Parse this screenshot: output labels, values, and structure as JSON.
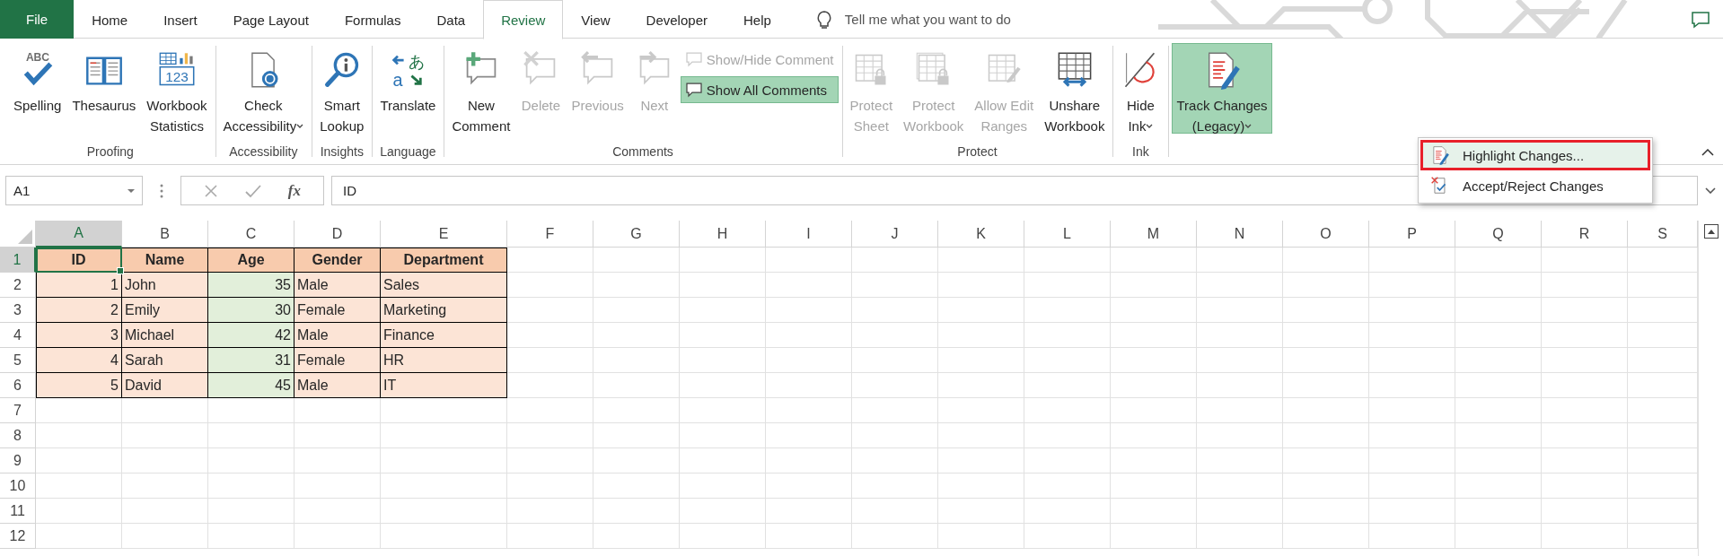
{
  "tabs": [
    {
      "label": "File",
      "kind": "file",
      "selected": false
    },
    {
      "label": "Home",
      "kind": "tab",
      "selected": false
    },
    {
      "label": "Insert",
      "kind": "tab",
      "selected": false
    },
    {
      "label": "Page Layout",
      "kind": "tab",
      "selected": false
    },
    {
      "label": "Formulas",
      "kind": "tab",
      "selected": false
    },
    {
      "label": "Data",
      "kind": "tab",
      "selected": false
    },
    {
      "label": "Review",
      "kind": "tab",
      "selected": true
    },
    {
      "label": "View",
      "kind": "tab",
      "selected": false
    },
    {
      "label": "Developer",
      "kind": "tab",
      "selected": false
    },
    {
      "label": "Help",
      "kind": "tab",
      "selected": false
    }
  ],
  "tell_me": {
    "placeholder": "Tell me what you want to do"
  },
  "ribbon": {
    "groups": [
      {
        "label": "Proofing",
        "buttons": [
          {
            "kind": "large",
            "label": "Spelling",
            "icon_texts": [
              "ABC"
            ],
            "disabled": false,
            "selected": false,
            "dropdown": false
          },
          {
            "kind": "large",
            "label": "Thesaurus",
            "disabled": false,
            "selected": false,
            "dropdown": false
          },
          {
            "kind": "large",
            "label": "Workbook\nStatistics",
            "icon_texts": [
              "123"
            ],
            "disabled": false,
            "selected": false,
            "dropdown": false
          }
        ]
      },
      {
        "label": "Accessibility",
        "buttons": [
          {
            "kind": "large",
            "label": "Check\nAccessibility",
            "disabled": false,
            "selected": false,
            "dropdown": true
          }
        ]
      },
      {
        "label": "Insights",
        "buttons": [
          {
            "kind": "large",
            "label": "Smart\nLookup",
            "disabled": false,
            "selected": false,
            "dropdown": false
          }
        ]
      },
      {
        "label": "Language",
        "buttons": [
          {
            "kind": "large",
            "label": "Translate",
            "icon_texts": [
              "あ",
              "a"
            ],
            "disabled": false,
            "selected": false,
            "dropdown": false
          }
        ]
      },
      {
        "label": "Comments",
        "buttons": [
          {
            "kind": "large",
            "label": "New\nComment",
            "disabled": false,
            "selected": false,
            "dropdown": false
          },
          {
            "kind": "large",
            "label": "Delete",
            "disabled": true,
            "selected": false,
            "dropdown": false
          },
          {
            "kind": "large",
            "label": "Previous",
            "disabled": true,
            "selected": false,
            "dropdown": false
          },
          {
            "kind": "large",
            "label": "Next",
            "disabled": true,
            "selected": false,
            "dropdown": false
          },
          {
            "kind": "small",
            "label": "Show/Hide Comment",
            "disabled": true,
            "selected": false,
            "dropdown": false
          },
          {
            "kind": "small",
            "label": "Show All Comments",
            "disabled": false,
            "selected": true,
            "dropdown": false
          }
        ]
      },
      {
        "label": "Protect",
        "buttons": [
          {
            "kind": "large",
            "label": "Protect\nSheet",
            "disabled": true,
            "selected": false,
            "dropdown": false
          },
          {
            "kind": "large",
            "label": "Protect\nWorkbook",
            "disabled": true,
            "selected": false,
            "dropdown": false
          },
          {
            "kind": "large",
            "label": "Allow Edit\nRanges",
            "disabled": true,
            "selected": false,
            "dropdown": false
          },
          {
            "kind": "large",
            "label": "Unshare\nWorkbook",
            "disabled": false,
            "selected": false,
            "dropdown": false
          }
        ]
      },
      {
        "label": "Ink",
        "buttons": [
          {
            "kind": "large",
            "label": "Hide\nInk",
            "disabled": false,
            "selected": false,
            "dropdown": true
          }
        ]
      },
      {
        "buttons": [
          {
            "kind": "large",
            "label": "Track Changes\n(Legacy)",
            "disabled": false,
            "selected": true,
            "dropdown": true
          }
        ]
      }
    ]
  },
  "formula_bar": {
    "name_box": "A1",
    "function_label": "fx",
    "formula": "ID"
  },
  "sheet": {
    "columns": [
      {
        "letter": "A",
        "selected": true
      },
      {
        "letter": "B",
        "selected": false
      },
      {
        "letter": "C",
        "selected": false
      },
      {
        "letter": "D",
        "selected": false
      },
      {
        "letter": "E",
        "selected": false
      },
      {
        "letter": "F",
        "selected": false
      },
      {
        "letter": "G",
        "selected": false
      },
      {
        "letter": "H",
        "selected": false
      },
      {
        "letter": "I",
        "selected": false
      },
      {
        "letter": "J",
        "selected": false
      },
      {
        "letter": "K",
        "selected": false
      },
      {
        "letter": "L",
        "selected": false
      },
      {
        "letter": "M",
        "selected": false
      },
      {
        "letter": "N",
        "selected": false
      },
      {
        "letter": "O",
        "selected": false
      },
      {
        "letter": "P",
        "selected": false
      },
      {
        "letter": "Q",
        "selected": false
      },
      {
        "letter": "R",
        "selected": false
      },
      {
        "letter": "S",
        "selected": false
      }
    ],
    "rows": [
      {
        "number": "1",
        "selected": true,
        "cells": [
          {
            "text": "ID",
            "kind": "header",
            "color": "#f8cbad",
            "selected": true
          },
          {
            "text": "Name",
            "kind": "header",
            "color": "#f8cbad",
            "selected": false
          },
          {
            "text": "Age",
            "kind": "header",
            "color": "#f8cbad",
            "selected": false
          },
          {
            "text": "Gender",
            "kind": "header",
            "color": "#f8cbad",
            "selected": false
          },
          {
            "text": "Department",
            "kind": "header",
            "color": "#f8cbad",
            "selected": false
          }
        ]
      },
      {
        "number": "2",
        "selected": false,
        "cells": [
          {
            "text": "1",
            "kind": "number",
            "color": "#fce4d6",
            "selected": false
          },
          {
            "text": "John",
            "kind": "text",
            "color": "#fce4d6",
            "selected": false
          },
          {
            "text": "35",
            "kind": "number",
            "color": "#e2efda",
            "selected": false
          },
          {
            "text": "Male",
            "kind": "text",
            "color": "#fce4d6",
            "selected": false
          },
          {
            "text": "Sales",
            "kind": "text",
            "color": "#fce4d6",
            "selected": false
          }
        ]
      },
      {
        "number": "3",
        "selected": false,
        "cells": [
          {
            "text": "2",
            "kind": "number",
            "color": "#fce4d6",
            "selected": false
          },
          {
            "text": "Emily",
            "kind": "text",
            "color": "#fce4d6",
            "selected": false
          },
          {
            "text": "30",
            "kind": "number",
            "color": "#e2efda",
            "selected": false
          },
          {
            "text": "Female",
            "kind": "text",
            "color": "#fce4d6",
            "selected": false
          },
          {
            "text": "Marketing",
            "kind": "text",
            "color": "#fce4d6",
            "selected": false
          }
        ]
      },
      {
        "number": "4",
        "selected": false,
        "cells": [
          {
            "text": "3",
            "kind": "number",
            "color": "#fce4d6",
            "selected": false
          },
          {
            "text": "Michael",
            "kind": "text",
            "color": "#fce4d6",
            "selected": false
          },
          {
            "text": "42",
            "kind": "number",
            "color": "#e2efda",
            "selected": false
          },
          {
            "text": "Male",
            "kind": "text",
            "color": "#fce4d6",
            "selected": false
          },
          {
            "text": "Finance",
            "kind": "text",
            "color": "#fce4d6",
            "selected": false
          }
        ]
      },
      {
        "number": "5",
        "selected": false,
        "cells": [
          {
            "text": "4",
            "kind": "number",
            "color": "#fce4d6",
            "selected": false
          },
          {
            "text": "Sarah",
            "kind": "text",
            "color": "#fce4d6",
            "selected": false
          },
          {
            "text": "31",
            "kind": "number",
            "color": "#e2efda",
            "selected": false
          },
          {
            "text": "Female",
            "kind": "text",
            "color": "#fce4d6",
            "selected": false
          },
          {
            "text": "HR",
            "kind": "text",
            "color": "#fce4d6",
            "selected": false
          }
        ]
      },
      {
        "number": "6",
        "selected": false,
        "cells": [
          {
            "text": "5",
            "kind": "number",
            "color": "#fce4d6",
            "selected": false
          },
          {
            "text": "David",
            "kind": "text",
            "color": "#fce4d6",
            "selected": false
          },
          {
            "text": "45",
            "kind": "number",
            "color": "#e2efda",
            "selected": false
          },
          {
            "text": "Male",
            "kind": "text",
            "color": "#fce4d6",
            "selected": false
          },
          {
            "text": "IT",
            "kind": "text",
            "color": "#fce4d6",
            "selected": false
          }
        ]
      },
      {
        "number": "7",
        "selected": false
      },
      {
        "number": "8",
        "selected": false
      },
      {
        "number": "9",
        "selected": false
      },
      {
        "number": "10",
        "selected": false
      },
      {
        "number": "11",
        "selected": false
      },
      {
        "number": "12",
        "selected": false
      }
    ]
  },
  "menu": {
    "items": [
      {
        "label": "Highlight Changes...",
        "selected": true
      },
      {
        "label": "Accept/Reject Changes",
        "selected": false
      }
    ]
  }
}
